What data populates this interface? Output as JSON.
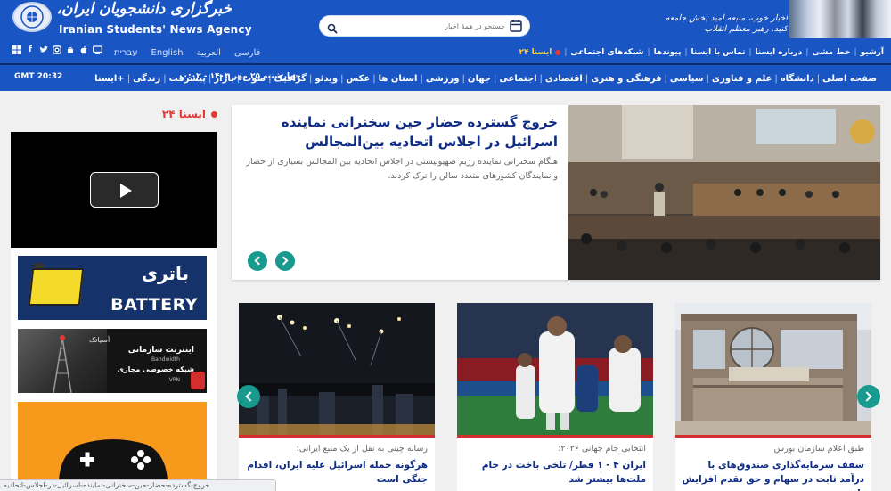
{
  "header": {
    "logo_fa": "خبرگزاری دانشجویان ایران، ایسنا",
    "logo_en": "Iranian Students' News Agency",
    "search_placeholder": "جستجو در همهٔ اخبار",
    "slogan": "اخبار خوب، منبعه امید بخش جامعه کنید. رهبر معظم انقلاب"
  },
  "nav_top": {
    "items": [
      "آرشیو",
      "خط مشی",
      "درباره ایسنا",
      "تماس با ایسنا",
      "پیوندها",
      "شبکه‌های اجتماعی"
    ],
    "isna24": "ایسنا ۲۴",
    "languages": [
      "فارسی",
      "العربية",
      "English",
      "עברית"
    ],
    "socials": [
      "windows-icon",
      "facebook-icon",
      "twitter-icon",
      "instagram-icon",
      "android-icon",
      "apple-icon",
      "tv-icon"
    ]
  },
  "nav_main": {
    "items": [
      "صفحه اصلی",
      "دانشگاه",
      "علم و فناوری",
      "سیاسی",
      "فرهنگی و هنری",
      "اقتصادی",
      "اجتماعی",
      "جهان",
      "ورزشی",
      "استان ها",
      "عکس",
      "ویدئو",
      "گرافیک",
      "صوت",
      "بازار",
      "پیشرفت",
      "زندگی",
      "ایسنا+"
    ],
    "date": "چهارشنبه ۲۵ مهر ۱۴۰۳ - ۰۰:۰۲",
    "time": "GMT 20:32"
  },
  "sidebar": {
    "title": "ایسنا ۲۴",
    "ads": {
      "battery_fa": "باتری",
      "battery_en": "BATTERY",
      "internet_brand": "آسیاتک",
      "internet_title": "اینترنت سازمانی",
      "internet_sub1": "Bandwidth",
      "internet_title2": "شبکه خصوصی مجازی",
      "internet_sub2": "VPN"
    }
  },
  "featured": {
    "title": "خروج گسترده حضار حین سخنرانی نماینده اسرائیل در اجلاس اتحادیه بین‌المجالس",
    "summary": "هنگام سخنرانی نماینده رژیم صهیونیستی در اجلاس اتحادیه بین المجالس بسیاری از حضار و نمایندگان کشورهای متعدد سالن را ترک کردند."
  },
  "cards": [
    {
      "category": "طبق اعلام سازمان بورس",
      "title": "سقف سرمایه‌گذاری صندوق‌های با درآمد ثابت در سهام و حق تقدم افزایش یافت"
    },
    {
      "category": "انتخابی جام جهانی ۲۰۲۶:",
      "title": "ایران ۴ - ۱ قطر/ تلخی باخت در جام ملت‌ها بیشتر شد"
    },
    {
      "category": "رسانه چینی به نقل از یک منبع ایرانی:",
      "title": "هرگونه حمله اسرائیل علیه ایران، اقدام جنگی است"
    }
  ],
  "statusbar": {
    "url": "خروج-گسترده-حضار-حین-سخنرانی-نماینده-اسرائیل-در-اجلاس-اتحادیه"
  }
}
